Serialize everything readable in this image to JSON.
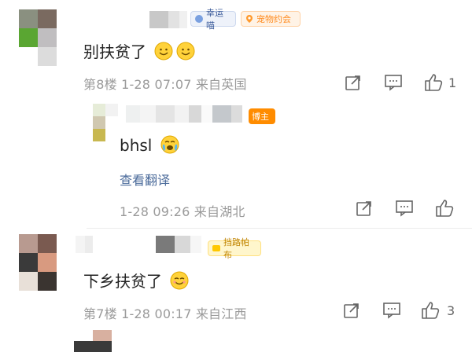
{
  "comments": [
    {
      "badges": [
        {
          "label": "幸运喵"
        },
        {
          "label": "宠物约会"
        }
      ],
      "text": "别扶贫了",
      "emoji": [
        "smile-emoji",
        "smile-emoji"
      ],
      "meta": "第8楼 1-28 07:07 来自英国",
      "likes": "1"
    },
    {
      "badges": [
        {
          "label": "博主"
        }
      ],
      "text": "bhsl",
      "emoji": [
        "cry-laugh-emoji"
      ],
      "translate": "查看翻译",
      "meta": "1-28 09:26 来自湖北",
      "likes": ""
    },
    {
      "badges": [
        {
          "label": "挡路帕布"
        }
      ],
      "text": "下乡扶贫了",
      "emoji": [
        "grin-emoji"
      ],
      "meta": "第7楼 1-28 00:17 来自江西",
      "likes": "3"
    }
  ],
  "icons": {
    "share": "share-icon",
    "comment": "comment-icon",
    "like": "thumbs-up-icon"
  },
  "colors": {
    "meta": "#9a9a9a",
    "link": "#4a6a9a",
    "blogger_badge": "#ff8c00",
    "pet_badge": "#ff9a2e"
  }
}
